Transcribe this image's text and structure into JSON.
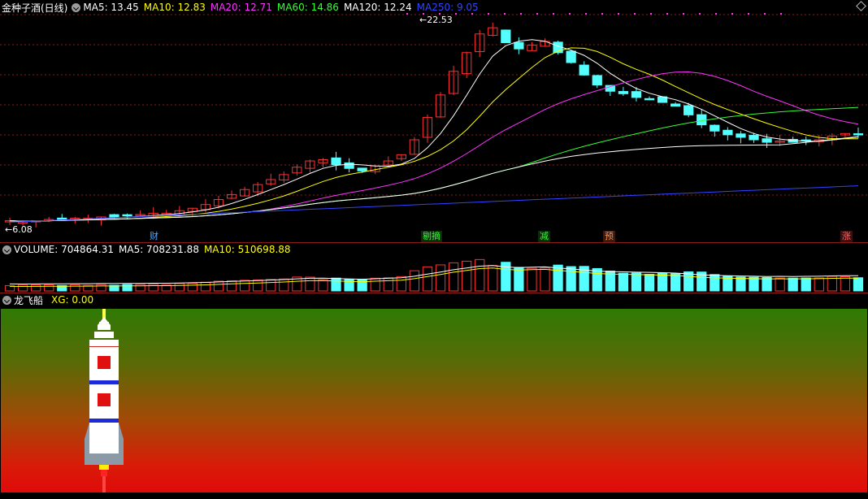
{
  "main": {
    "title": "金种子酒(日线)",
    "ma": [
      {
        "label": "MA5: 13.45",
        "color": "#ffffff"
      },
      {
        "label": "MA10: 12.83",
        "color": "#ffff00"
      },
      {
        "label": "MA20: 12.71",
        "color": "#ff33ff"
      },
      {
        "label": "MA60: 14.86",
        "color": "#33ff33"
      },
      {
        "label": "MA120: 12.24",
        "color": "#ffffff"
      },
      {
        "label": "MA250: 9.05",
        "color": "#3344ff"
      }
    ],
    "high_label": "22.53",
    "low_label": "6.08",
    "events": [
      {
        "label": "财",
        "color": "#55aaff",
        "bg": "#1a1a3a"
      },
      {
        "label": "剔摘",
        "color": "#33ff33",
        "bg": "#1a2a1a"
      },
      {
        "label": "减",
        "color": "#33ff33",
        "bg": "#1a2a1a"
      },
      {
        "label": "预",
        "color": "#ff8844",
        "bg": "#3a1a10"
      },
      {
        "label": "涨",
        "color": "#ff6666",
        "bg": "#3a1010"
      }
    ]
  },
  "volume": {
    "title": "VOLUME: 704864.31",
    "ma5": "MA5: 708231.88",
    "ma10": "MA10: 510698.88"
  },
  "indicator": {
    "title": "龙飞船",
    "xg": "XG: 0.00"
  },
  "colors": {
    "up": "#ff3030",
    "down": "#54ffff",
    "ma5": "#ffffff",
    "ma10": "#ffff00",
    "ma20": "#ff33ff",
    "ma60": "#33ff33",
    "ma120": "#ffffff",
    "ma250": "#3344ff",
    "grid": "#8b1a1a"
  },
  "chart_data": {
    "type": "candlestick",
    "title": "金种子酒(日线)",
    "yrange": [
      6.08,
      22.53
    ],
    "close_approx": [
      6.5,
      6.4,
      6.5,
      6.6,
      6.6,
      6.7,
      6.7,
      6.8,
      6.8,
      6.9,
      7.0,
      7.1,
      7.1,
      7.3,
      7.5,
      7.8,
      8.2,
      8.6,
      9.0,
      9.4,
      9.8,
      10.2,
      10.8,
      11.3,
      11.4,
      11.0,
      10.7,
      10.5,
      10.9,
      11.3,
      11.8,
      13.0,
      14.8,
      16.6,
      18.5,
      20.0,
      21.5,
      22.0,
      20.8,
      20.3,
      20.6,
      20.9,
      20.0,
      19.2,
      18.2,
      17.4,
      16.9,
      16.7,
      16.4,
      16.3,
      16.0,
      15.7,
      15.0,
      14.2,
      13.7,
      13.4,
      13.2,
      13.0,
      12.8,
      12.9,
      12.8,
      12.9,
      13.0,
      13.3,
      13.5,
      13.45
    ]
  }
}
